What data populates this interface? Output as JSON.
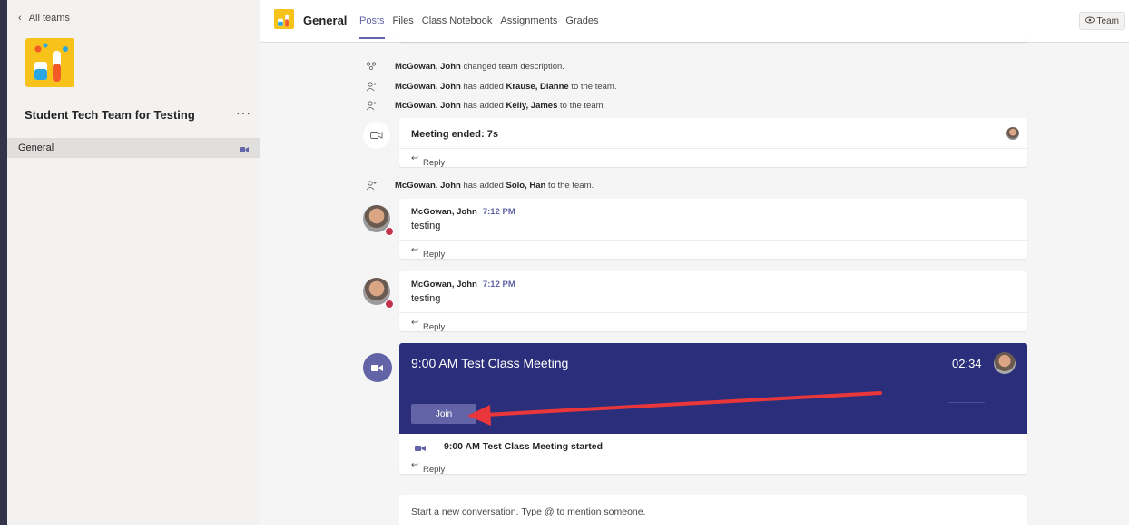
{
  "sidebar": {
    "back_label": "All teams",
    "team_name": "Student Tech Team for Testing",
    "more_label": "···",
    "channels": [
      {
        "label": "General"
      }
    ]
  },
  "header": {
    "title": "General",
    "tabs": [
      {
        "label": "Posts",
        "active": true
      },
      {
        "label": "Files"
      },
      {
        "label": "Class Notebook"
      },
      {
        "label": "Assignments"
      },
      {
        "label": "Grades"
      }
    ],
    "team_button": "Team"
  },
  "feed": {
    "system_1": {
      "actor": "McGowan, John",
      "text": " changed team description."
    },
    "system_2": {
      "actor": "McGowan, John",
      "mid": " has added ",
      "target": "Krause, Dianne",
      "tail": " to the team."
    },
    "system_3": {
      "actor": "McGowan, John",
      "mid": " has added ",
      "target": "Kelly, James",
      "tail": " to the team."
    },
    "meeting_ended": {
      "text": "Meeting ended: 7s"
    },
    "system_4": {
      "actor": "McGowan, John",
      "mid": " has added ",
      "target": "Solo, Han",
      "tail": " to the team."
    },
    "messages": [
      {
        "author": "McGowan, John",
        "time": "7:12 PM",
        "body": "testing"
      },
      {
        "author": "McGowan, John",
        "time": "7:12 PM",
        "body": "testing"
      }
    ],
    "meeting": {
      "title": "9:00 AM Test Class Meeting",
      "timer": "02:34",
      "join_label": "Join",
      "started_text": "9:00 AM Test Class Meeting started"
    },
    "reply_label": "Reply"
  },
  "compose": {
    "placeholder": "Start a new conversation. Type @ to mention someone."
  },
  "colors": {
    "accent": "#6264a7",
    "meeting_banner": "#2b2f7b",
    "arrow": "#e8363a",
    "presence_busy": "#c4314b"
  }
}
